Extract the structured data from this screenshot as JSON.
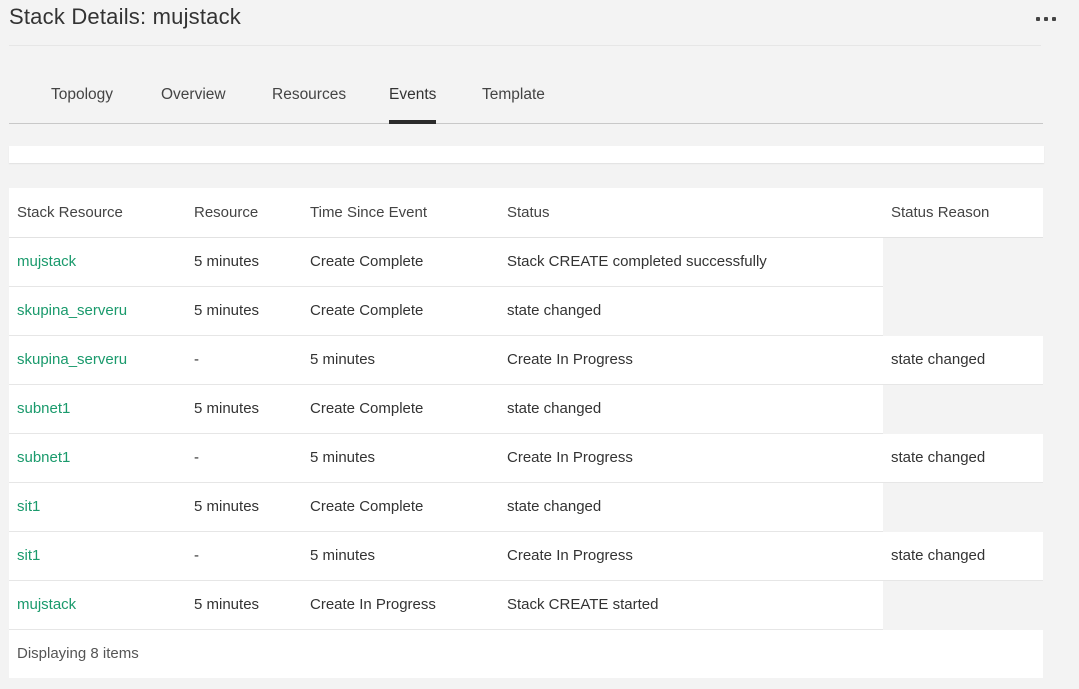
{
  "page": {
    "title": "Stack Details: mujstack"
  },
  "tabs": [
    {
      "label": "Topology",
      "active": false
    },
    {
      "label": "Overview",
      "active": false
    },
    {
      "label": "Resources",
      "active": false
    },
    {
      "label": "Events",
      "active": true
    },
    {
      "label": "Template",
      "active": false
    }
  ],
  "table": {
    "headers": [
      "Stack Resource",
      "Resource",
      "Time Since Event",
      "Status",
      "Status Reason"
    ],
    "rows": [
      {
        "stack_resource": "mujstack",
        "resource": "5 minutes",
        "time": "Create Complete",
        "status": "Stack CREATE completed successfully",
        "reason": ""
      },
      {
        "stack_resource": "skupina_serveru",
        "resource": "5 minutes",
        "time": "Create Complete",
        "status": "state changed",
        "reason": ""
      },
      {
        "stack_resource": "skupina_serveru",
        "resource": "-",
        "time": "5 minutes",
        "status": "Create In Progress",
        "reason": "state changed"
      },
      {
        "stack_resource": "subnet1",
        "resource": "5 minutes",
        "time": "Create Complete",
        "status": "state changed",
        "reason": ""
      },
      {
        "stack_resource": "subnet1",
        "resource": "-",
        "time": "5 minutes",
        "status": "Create In Progress",
        "reason": "state changed"
      },
      {
        "stack_resource": "sit1",
        "resource": "5 minutes",
        "time": "Create Complete",
        "status": "state changed",
        "reason": ""
      },
      {
        "stack_resource": "sit1",
        "resource": "-",
        "time": "5 minutes",
        "status": "Create In Progress",
        "reason": "state changed"
      },
      {
        "stack_resource": "mujstack",
        "resource": "5 minutes",
        "time": "Create In Progress",
        "status": "Stack CREATE started",
        "reason": ""
      }
    ],
    "footer": "Displaying 8 items"
  },
  "colors": {
    "link": "#1a9a6c",
    "background": "#f3f3f3",
    "active_tab_underline": "#2b2b2b"
  },
  "icons": {
    "more": "more-horizontal-icon"
  }
}
